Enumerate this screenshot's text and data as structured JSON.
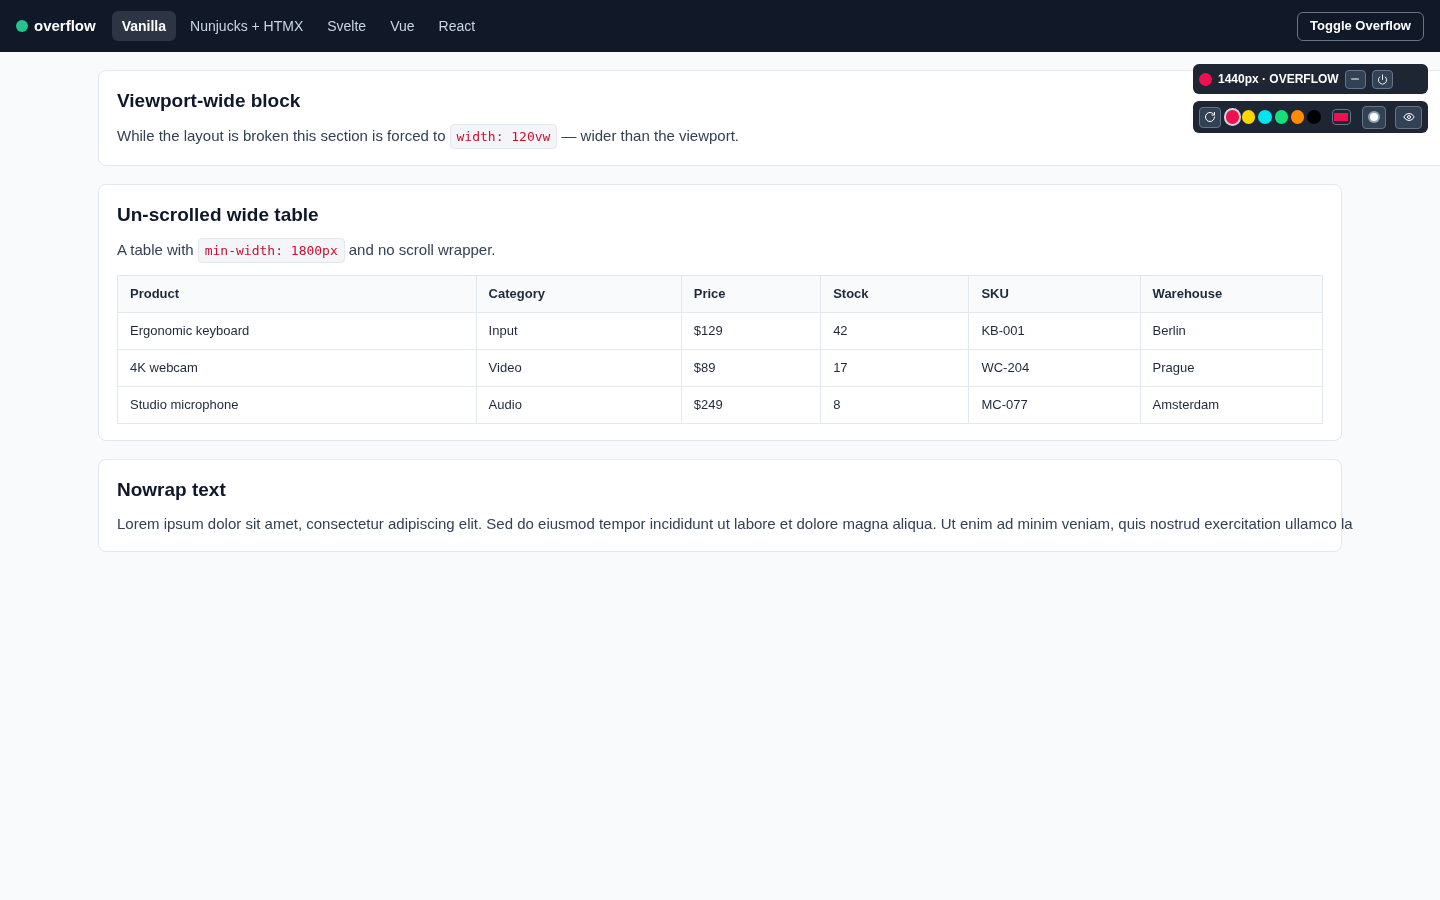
{
  "nav": {
    "brand": "overflow",
    "tabs": [
      {
        "label": "Vanilla",
        "selected": true
      },
      {
        "label": "Nunjucks + HTMX",
        "selected": false
      },
      {
        "label": "Svelte",
        "selected": false
      },
      {
        "label": "Vue",
        "selected": false
      },
      {
        "label": "React",
        "selected": false
      }
    ],
    "toggle_button": "Toggle Overflow"
  },
  "debug_panel": {
    "status": "1440px · OVERFLOW",
    "swatches": [
      {
        "color": "#f0104f",
        "selected": true
      },
      {
        "color": "#ffd500",
        "selected": false
      },
      {
        "color": "#00e5f0",
        "selected": false
      },
      {
        "color": "#14e07a",
        "selected": false
      },
      {
        "color": "#ff8c00",
        "selected": false
      },
      {
        "color": "#000000",
        "selected": false
      }
    ]
  },
  "sections": [
    {
      "title": "Viewport-wide block",
      "text_before": "While the layout is broken this section is forced to",
      "code": "width: 120vw",
      "text_after": "— wider than the viewport."
    },
    {
      "title": "Un-scrolled wide table",
      "text_before": "A table with",
      "code": "min-width: 1800px",
      "text_after": "and no scroll wrapper.",
      "table": {
        "columns": [
          "Product",
          "Category",
          "Price",
          "Stock",
          "SKU",
          "Warehouse"
        ],
        "rows": [
          [
            "Ergonomic keyboard",
            "Input",
            "$129",
            "42",
            "KB-001",
            "Berlin"
          ],
          [
            "4K webcam",
            "Video",
            "$89",
            "17",
            "WC-204",
            "Prague"
          ],
          [
            "Studio microphone",
            "Audio",
            "$249",
            "8",
            "MC-077",
            "Amsterdam"
          ]
        ]
      }
    },
    {
      "title": "Nowrap text",
      "paragraph": "Lorem ipsum dolor sit amet, consectetur adipiscing elit. Sed do eiusmod tempor incididunt ut labore et dolore magna aliqua. Ut enim ad minim veniam, quis nostrud exercitation ullamco la"
    }
  ]
}
